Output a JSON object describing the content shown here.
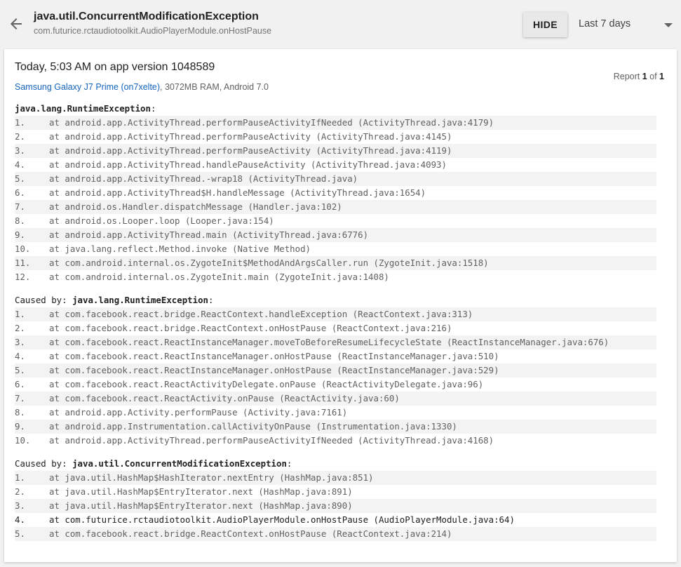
{
  "header": {
    "title": "java.util.ConcurrentModificationException",
    "subtitle": "com.futurice.rctaudiotoolkit.AudioPlayerModule.onHostPause",
    "hide_label": "HIDE",
    "range_value": "Last 7 days"
  },
  "report": {
    "heading": "Today, 5:03 AM on app version 1048589",
    "device_name": "Samsung Galaxy J7 Prime (on7xelte)",
    "device_specs": ", 3072MB RAM, Android 7.0",
    "counter_prefix": "Report ",
    "counter_current": "1",
    "counter_mid": " of ",
    "counter_total": "1"
  },
  "traces": [
    {
      "prefix": "",
      "exception": "java.lang.RuntimeException",
      "suffix": ":",
      "frames": [
        "at android.app.ActivityThread.performPauseActivityIfNeeded (ActivityThread.java:4179)",
        "at android.app.ActivityThread.performPauseActivity (ActivityThread.java:4145)",
        "at android.app.ActivityThread.performPauseActivity (ActivityThread.java:4119)",
        "at android.app.ActivityThread.handlePauseActivity (ActivityThread.java:4093)",
        "at android.app.ActivityThread.-wrap18 (ActivityThread.java)",
        "at android.app.ActivityThread$H.handleMessage (ActivityThread.java:1654)",
        "at android.os.Handler.dispatchMessage (Handler.java:102)",
        "at android.os.Looper.loop (Looper.java:154)",
        "at android.app.ActivityThread.main (ActivityThread.java:6776)",
        "at java.lang.reflect.Method.invoke (Native Method)",
        "at com.android.internal.os.ZygoteInit$MethodAndArgsCaller.run (ZygoteInit.java:1518)",
        "at com.android.internal.os.ZygoteInit.main (ZygoteInit.java:1408)"
      ]
    },
    {
      "prefix": "Caused by: ",
      "exception": "java.lang.RuntimeException",
      "suffix": ":",
      "frames": [
        "at com.facebook.react.bridge.ReactContext.handleException (ReactContext.java:313)",
        "at com.facebook.react.bridge.ReactContext.onHostPause (ReactContext.java:216)",
        "at com.facebook.react.ReactInstanceManager.moveToBeforeResumeLifecycleState (ReactInstanceManager.java:676)",
        "at com.facebook.react.ReactInstanceManager.onHostPause (ReactInstanceManager.java:510)",
        "at com.facebook.react.ReactInstanceManager.onHostPause (ReactInstanceManager.java:529)",
        "at com.facebook.react.ReactActivityDelegate.onPause (ReactActivityDelegate.java:96)",
        "at com.facebook.react.ReactActivity.onPause (ReactActivity.java:60)",
        "at android.app.Activity.performPause (Activity.java:7161)",
        "at android.app.Instrumentation.callActivityOnPause (Instrumentation.java:1330)",
        "at android.app.ActivityThread.performPauseActivityIfNeeded (ActivityThread.java:4168)"
      ]
    },
    {
      "prefix": "Caused by: ",
      "exception": "java.util.ConcurrentModificationException",
      "suffix": ":",
      "frames": [
        "at java.util.HashMap$HashIterator.nextEntry (HashMap.java:851)",
        "at java.util.HashMap$EntryIterator.next (HashMap.java:891)",
        "at java.util.HashMap$EntryIterator.next (HashMap.java:890)",
        "at com.futurice.rctaudiotoolkit.AudioPlayerModule.onHostPause (AudioPlayerModule.java:64)",
        "at com.facebook.react.bridge.ReactContext.onHostPause (ReactContext.java:214)"
      ]
    }
  ]
}
